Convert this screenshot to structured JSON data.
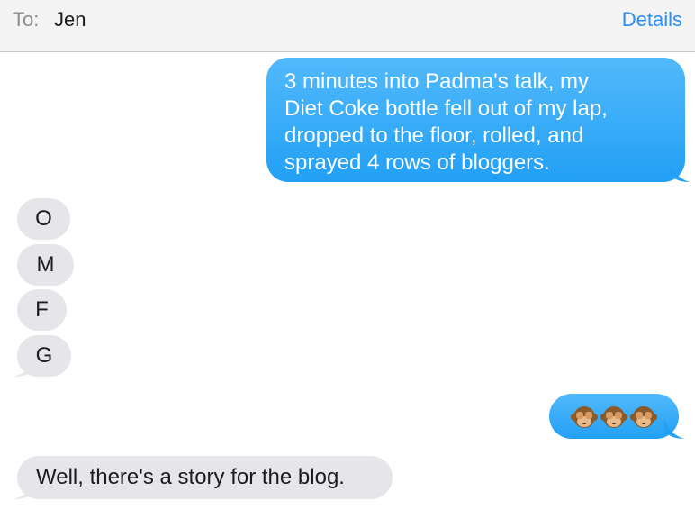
{
  "header": {
    "to_label": "To:",
    "recipient": "Jen",
    "details_label": "Details"
  },
  "messages": {
    "sent_1": {
      "line1": "3 minutes into Padma's talk, my",
      "line2": "Diet Coke bottle fell out of my lap,",
      "line3": "dropped to the floor, rolled, and",
      "line4": "sprayed 4 rows of bloggers."
    },
    "received_letters": [
      "O",
      "M",
      "F",
      "G"
    ],
    "sent_emoji": {
      "icons": [
        "see-no-evil-monkey-icon",
        "see-no-evil-monkey-icon",
        "see-no-evil-monkey-icon"
      ]
    },
    "received_last": "Well, there's a story for the blog."
  },
  "colors": {
    "header_bg": "#f4f4f5",
    "accent": "#2a8ff7",
    "sent_bubble": "#36aaf8",
    "received_bubble": "#e5e5ea"
  }
}
